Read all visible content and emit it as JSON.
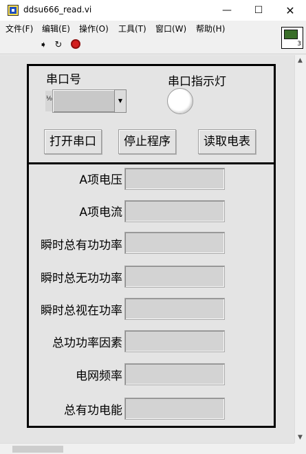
{
  "window": {
    "title": "ddsu666_read.vi",
    "min_glyph": "—",
    "max_glyph": "☐",
    "close_glyph": "✕"
  },
  "menu": [
    "文件(F)",
    "编辑(E)",
    "操作(O)",
    "工具(T)",
    "窗口(W)",
    "帮助(H)"
  ],
  "toolbar": {
    "run_icon": "run-arrow-icon",
    "run_glyph": "➧",
    "continuous_icon": "run-continuously-icon",
    "continuous_glyph": "↻",
    "abort_icon": "abort-icon"
  },
  "vi_icon": {
    "badge": "3"
  },
  "controls": {
    "serial_port_label": "串口号",
    "serial_port_value": "",
    "radix_glyph": "⅟₀",
    "indicator_label": "串口指示灯",
    "indicator_on": false,
    "buttons": {
      "open": "打开串口",
      "stop": "停止程序",
      "read": "读取电表"
    }
  },
  "indicators": [
    {
      "label": "A项电压",
      "value": ""
    },
    {
      "label": "A项电流",
      "value": ""
    },
    {
      "label": "瞬时总有功功率",
      "value": ""
    },
    {
      "label": "瞬时总无功功率",
      "value": ""
    },
    {
      "label": "瞬时总视在功率",
      "value": ""
    },
    {
      "label": "总功功率因素",
      "value": ""
    },
    {
      "label": "电网频率",
      "value": ""
    },
    {
      "label": "总有功电能",
      "value": ""
    }
  ],
  "colors": {
    "panel": "#e4e4e4",
    "indicator_fill": "#d3d3d3",
    "led_off": "#ffffff",
    "abort": "#d31f1f"
  }
}
